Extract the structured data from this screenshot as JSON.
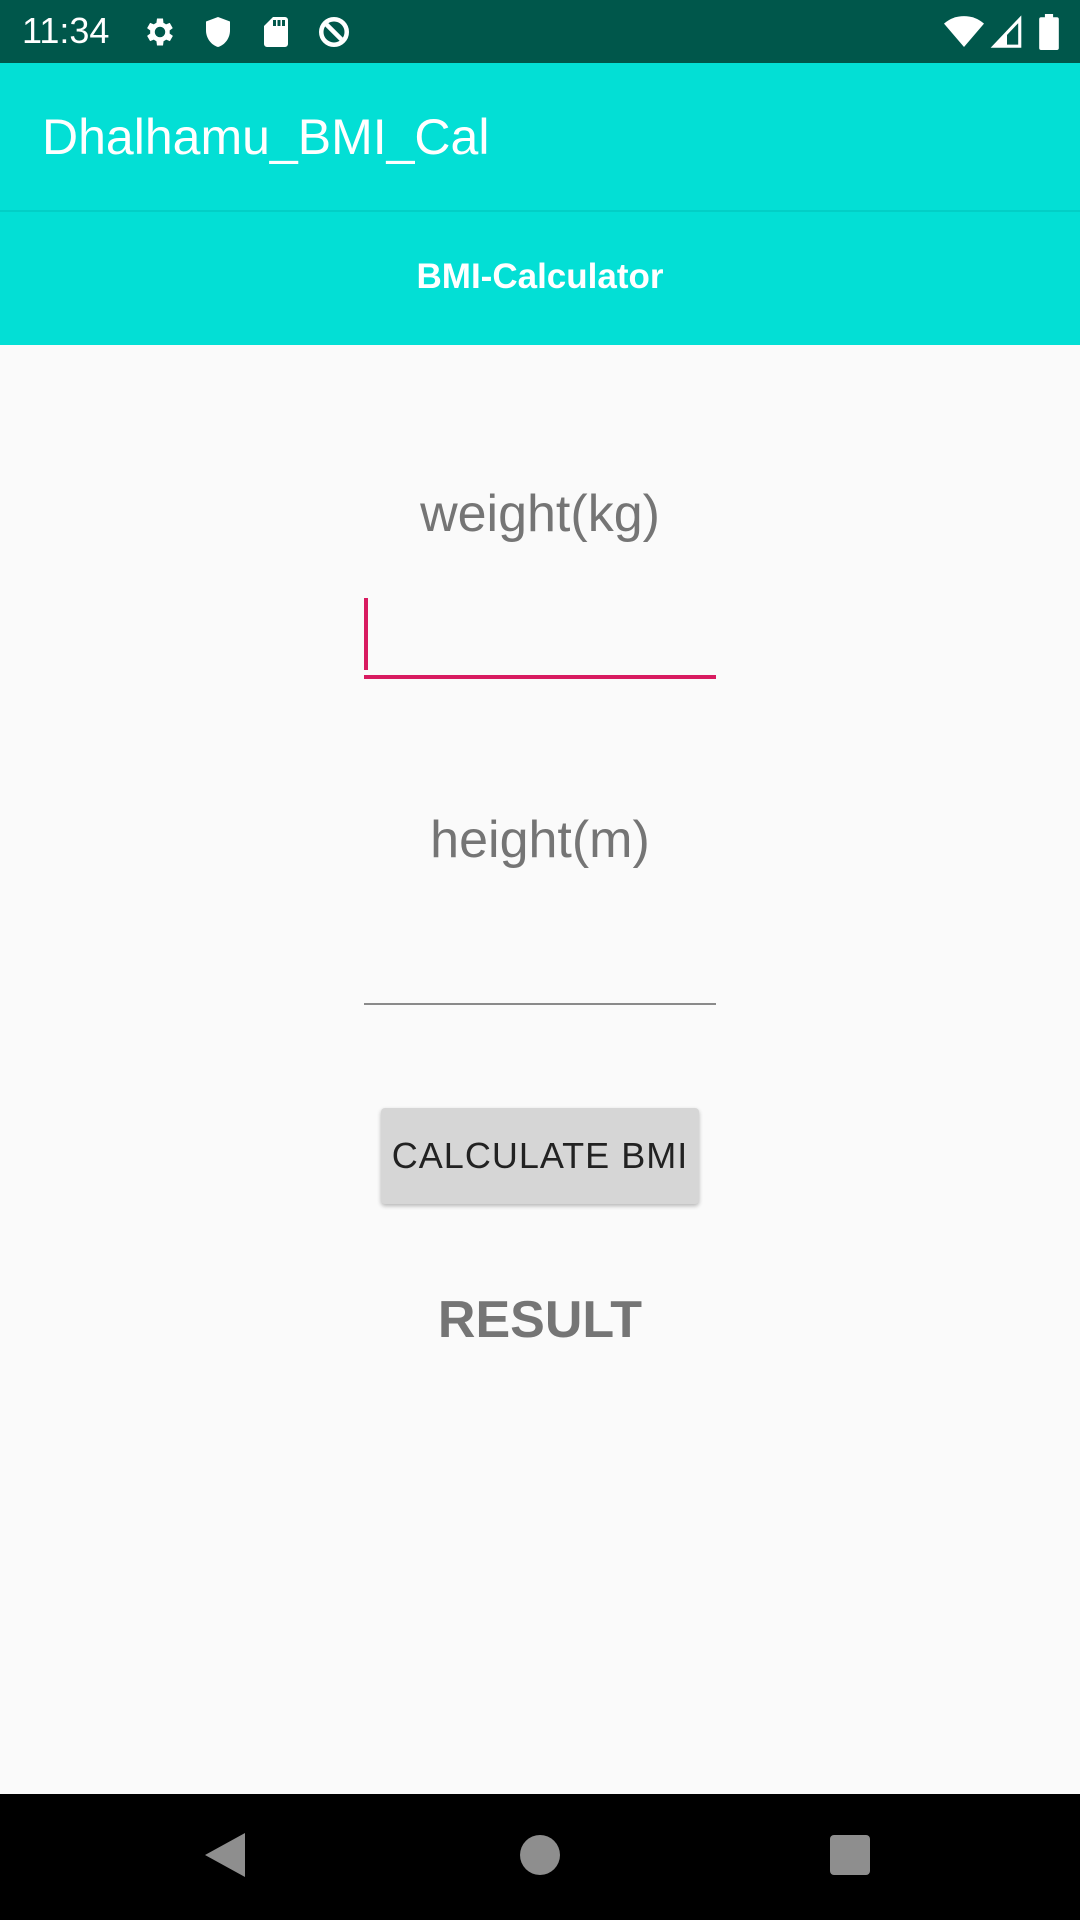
{
  "status_bar": {
    "time": "11:34",
    "icons_left": [
      "gear-icon",
      "shield-icon",
      "sd-card-icon",
      "data-saver-icon"
    ],
    "icons_right": [
      "wifi-icon",
      "cellular-signal-icon",
      "battery-icon"
    ]
  },
  "app_bar": {
    "title": "Dhalhamu_BMI_Cal",
    "color": "#03dfd5"
  },
  "header": {
    "text": "BMI-Calculator"
  },
  "form": {
    "weight_label": "weight(kg)",
    "weight_value": "",
    "height_label": "height(m)",
    "height_value": "",
    "focused_field": "weight",
    "accent_color": "#d81b60"
  },
  "calculate_button": {
    "label": "CALCULATE BMI"
  },
  "result": {
    "text": "RESULT"
  },
  "nav_bar": {
    "buttons": [
      "back-icon",
      "home-icon",
      "recents-icon"
    ]
  }
}
